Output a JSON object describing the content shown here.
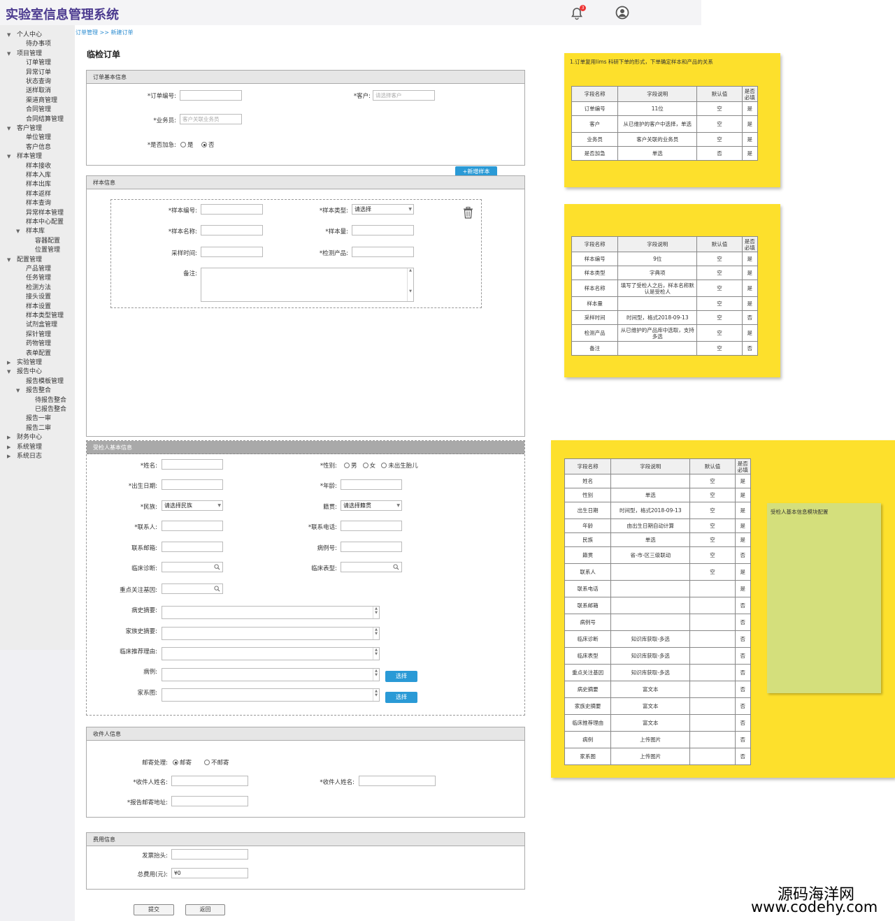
{
  "app": {
    "title": "实验室信息管理系统",
    "notifications": "3"
  },
  "breadcrumb": "订单管理 >> 新建订单",
  "page_title": "临检订单",
  "sidebar": [
    {
      "label": "个人中心",
      "level": 0,
      "caret": "▼"
    },
    {
      "label": "待办事项",
      "level": 1
    },
    {
      "label": "项目管理",
      "level": 0,
      "caret": "▼"
    },
    {
      "label": "订单管理",
      "level": 1
    },
    {
      "label": "异常订单",
      "level": 1
    },
    {
      "label": "状态查询",
      "level": 1
    },
    {
      "label": "送样取消",
      "level": 1
    },
    {
      "label": "渠道商管理",
      "level": 1
    },
    {
      "label": "合同管理",
      "level": 1
    },
    {
      "label": "合同结算管理",
      "level": 1
    },
    {
      "label": "客户管理",
      "level": 0,
      "caret": "▼"
    },
    {
      "label": "单位管理",
      "level": 1
    },
    {
      "label": "客户信息",
      "level": 1
    },
    {
      "label": "样本管理",
      "level": 0,
      "caret": "▼"
    },
    {
      "label": "样本接收",
      "level": 1
    },
    {
      "label": "样本入库",
      "level": 1
    },
    {
      "label": "样本出库",
      "level": 1
    },
    {
      "label": "样本返样",
      "level": 1
    },
    {
      "label": "样本查询",
      "level": 1
    },
    {
      "label": "异常样本管理",
      "level": 1
    },
    {
      "label": "样本中心配置",
      "level": 1
    },
    {
      "label": "样本库",
      "level": 1,
      "caret": "▼"
    },
    {
      "label": "容器配置",
      "level": 2
    },
    {
      "label": "位置管理",
      "level": 2
    },
    {
      "label": "配置管理",
      "level": 0,
      "caret": "▼"
    },
    {
      "label": "产品管理",
      "level": 1
    },
    {
      "label": "任务管理",
      "level": 1
    },
    {
      "label": "检测方法",
      "level": 1
    },
    {
      "label": "接头设置",
      "level": 1
    },
    {
      "label": "样本设置",
      "level": 1
    },
    {
      "label": "样本类型管理",
      "level": 1
    },
    {
      "label": "试剂盒管理",
      "level": 1
    },
    {
      "label": "探针管理",
      "level": 1
    },
    {
      "label": "药物管理",
      "level": 1
    },
    {
      "label": "表单配置",
      "level": 1
    },
    {
      "label": "实验管理",
      "level": 0,
      "caret": "▶"
    },
    {
      "label": "报告中心",
      "level": 0,
      "caret": "▼"
    },
    {
      "label": "报告模板管理",
      "level": 1
    },
    {
      "label": "报告整合",
      "level": 1,
      "caret": "▼"
    },
    {
      "label": "待报告整合",
      "level": 2
    },
    {
      "label": "已报告整合",
      "level": 2
    },
    {
      "label": "报告一审",
      "level": 1
    },
    {
      "label": "报告二审",
      "level": 1
    },
    {
      "label": "财务中心",
      "level": 0,
      "caret": "▶"
    },
    {
      "label": "系统管理",
      "level": 0,
      "caret": "▶"
    },
    {
      "label": "系统日志",
      "level": 0,
      "caret": "▶"
    }
  ],
  "order": {
    "header": "订单基本信息",
    "order_no_label": "*订单编号:",
    "customer_label": "*客户:",
    "customer_placeholder": "请选择客户",
    "sales_label": "*业务员:",
    "sales_placeholder": "客户关联业务员",
    "urgent_label": "*是否加急:",
    "urgent_yes": "是",
    "urgent_no": "否"
  },
  "add_sample_button": "+新增样本",
  "sample": {
    "header": "样本信息",
    "sample_no": "*样本编号:",
    "sample_type": "*样本类型:",
    "sample_type_value": "请选择",
    "sample_name": "*样本名称:",
    "sample_qty": "*样本量:",
    "collect_time": "采样时间:",
    "product": "*检测产品:",
    "remark": "备注:"
  },
  "patient": {
    "header": "受检人基本信息",
    "name": "*姓名:",
    "gender": "*性别:",
    "male": "男",
    "female": "女",
    "unborn": "未出生胎儿",
    "birth": "*出生日期:",
    "age": "*年龄:",
    "ethnic": "*民族:",
    "ethnic_value": "请选择民族",
    "native": "籍贯:",
    "native_value": "请选择籍贯",
    "contact": "*联系人:",
    "phone": "*联系电话:",
    "email": "联系邮箱:",
    "case_no": "病例号:",
    "diagnosis": "临床诊断:",
    "phenotype": "临床表型:",
    "gene": "重点关注基因:",
    "history": "病史摘要:",
    "family_history": "家族史摘要:",
    "reason": "临床推荐理由:",
    "case": "病例:",
    "pedigree": "家系图:",
    "choose": "选择"
  },
  "receiver": {
    "header": "收件人信息",
    "mail": "邮寄处理:",
    "mail_yes": "邮寄",
    "mail_no": "不邮寄",
    "name1": "*收件人姓名:",
    "name2": "*收件人姓名:",
    "address": "*报告邮寄地址:"
  },
  "fee": {
    "header": "费用信息",
    "invoice": "发票抬头:",
    "total": "总费用(元):",
    "total_value": "¥0"
  },
  "actions": {
    "submit": "提交",
    "back": "返回"
  },
  "notes": {
    "note1_title": "1.订单复用lims 科研下单的形式，下单确定样本和产品的关系",
    "headers": [
      "字段名称",
      "字段说明",
      "默认值",
      "是否必填"
    ],
    "table1": [
      [
        "订单编号",
        "11位",
        "空",
        "是"
      ],
      [
        "客户",
        "从已维护的客户中选择，单选",
        "空",
        "是"
      ],
      [
        "业务员",
        "客户关联的业务员",
        "空",
        "是"
      ],
      [
        "是否加急",
        "单选",
        "否",
        "是"
      ]
    ],
    "table2": [
      [
        "样本编号",
        "9位",
        "空",
        "是"
      ],
      [
        "样本类型",
        "字典项",
        "空",
        "是"
      ],
      [
        "样本名称",
        "填写了受检人之后，样本名称默认是受检人",
        "空",
        "是"
      ],
      [
        "样本量",
        "",
        "空",
        "是"
      ],
      [
        "采样时间",
        "时间型，格式2018-09-13",
        "空",
        "否"
      ],
      [
        "检测产品",
        "从已维护的产品库中选取，支持多选",
        "空",
        "是"
      ],
      [
        "备注",
        "",
        "空",
        "否"
      ]
    ],
    "table3": [
      [
        "姓名",
        "",
        "空",
        "是"
      ],
      [
        "性别",
        "单选",
        "空",
        "是"
      ],
      [
        "出生日期",
        "时间型，格式2018-09-13",
        "空",
        "是"
      ],
      [
        "年龄",
        "由出生日期自动计算",
        "空",
        "是"
      ],
      [
        "民族",
        "单选",
        "空",
        "是"
      ],
      [
        "籍贯",
        "省-市-区三级联动",
        "空",
        "否"
      ],
      [
        "联系人",
        "",
        "空",
        "是"
      ],
      [
        "联系电话",
        "",
        "",
        "是"
      ],
      [
        "联系邮箱",
        "",
        "",
        "否"
      ],
      [
        "病例号",
        "",
        "",
        "否"
      ],
      [
        "临床诊断",
        "知识库获取-多选",
        "",
        "否"
      ],
      [
        "临床表型",
        "知识库获取-多选",
        "",
        "否"
      ],
      [
        "重点关注基因",
        "知识库获取-多选",
        "",
        "否"
      ],
      [
        "病史摘要",
        "富文本",
        "",
        "否"
      ],
      [
        "家族史摘要",
        "富文本",
        "",
        "否"
      ],
      [
        "临床推荐理由",
        "富文本",
        "",
        "否"
      ],
      [
        "病例",
        "上传图片",
        "",
        "否"
      ],
      [
        "家系图",
        "上传图片",
        "",
        "否"
      ]
    ],
    "green_note": "受检人基本信息模块配置"
  },
  "watermark": {
    "cn": "源码海洋网",
    "url": "www.codehy.com"
  }
}
